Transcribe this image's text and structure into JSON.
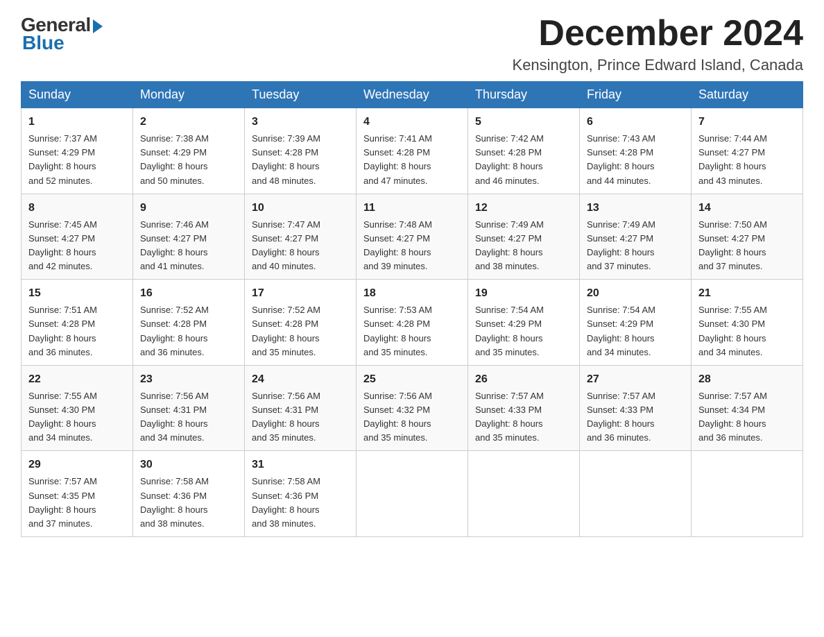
{
  "logo": {
    "general": "General",
    "blue": "Blue"
  },
  "title": "December 2024",
  "location": "Kensington, Prince Edward Island, Canada",
  "days_of_week": [
    "Sunday",
    "Monday",
    "Tuesday",
    "Wednesday",
    "Thursday",
    "Friday",
    "Saturday"
  ],
  "weeks": [
    [
      {
        "day": "1",
        "sunrise": "7:37 AM",
        "sunset": "4:29 PM",
        "daylight": "8 hours and 52 minutes."
      },
      {
        "day": "2",
        "sunrise": "7:38 AM",
        "sunset": "4:29 PM",
        "daylight": "8 hours and 50 minutes."
      },
      {
        "day": "3",
        "sunrise": "7:39 AM",
        "sunset": "4:28 PM",
        "daylight": "8 hours and 48 minutes."
      },
      {
        "day": "4",
        "sunrise": "7:41 AM",
        "sunset": "4:28 PM",
        "daylight": "8 hours and 47 minutes."
      },
      {
        "day": "5",
        "sunrise": "7:42 AM",
        "sunset": "4:28 PM",
        "daylight": "8 hours and 46 minutes."
      },
      {
        "day": "6",
        "sunrise": "7:43 AM",
        "sunset": "4:28 PM",
        "daylight": "8 hours and 44 minutes."
      },
      {
        "day": "7",
        "sunrise": "7:44 AM",
        "sunset": "4:27 PM",
        "daylight": "8 hours and 43 minutes."
      }
    ],
    [
      {
        "day": "8",
        "sunrise": "7:45 AM",
        "sunset": "4:27 PM",
        "daylight": "8 hours and 42 minutes."
      },
      {
        "day": "9",
        "sunrise": "7:46 AM",
        "sunset": "4:27 PM",
        "daylight": "8 hours and 41 minutes."
      },
      {
        "day": "10",
        "sunrise": "7:47 AM",
        "sunset": "4:27 PM",
        "daylight": "8 hours and 40 minutes."
      },
      {
        "day": "11",
        "sunrise": "7:48 AM",
        "sunset": "4:27 PM",
        "daylight": "8 hours and 39 minutes."
      },
      {
        "day": "12",
        "sunrise": "7:49 AM",
        "sunset": "4:27 PM",
        "daylight": "8 hours and 38 minutes."
      },
      {
        "day": "13",
        "sunrise": "7:49 AM",
        "sunset": "4:27 PM",
        "daylight": "8 hours and 37 minutes."
      },
      {
        "day": "14",
        "sunrise": "7:50 AM",
        "sunset": "4:27 PM",
        "daylight": "8 hours and 37 minutes."
      }
    ],
    [
      {
        "day": "15",
        "sunrise": "7:51 AM",
        "sunset": "4:28 PM",
        "daylight": "8 hours and 36 minutes."
      },
      {
        "day": "16",
        "sunrise": "7:52 AM",
        "sunset": "4:28 PM",
        "daylight": "8 hours and 36 minutes."
      },
      {
        "day": "17",
        "sunrise": "7:52 AM",
        "sunset": "4:28 PM",
        "daylight": "8 hours and 35 minutes."
      },
      {
        "day": "18",
        "sunrise": "7:53 AM",
        "sunset": "4:28 PM",
        "daylight": "8 hours and 35 minutes."
      },
      {
        "day": "19",
        "sunrise": "7:54 AM",
        "sunset": "4:29 PM",
        "daylight": "8 hours and 35 minutes."
      },
      {
        "day": "20",
        "sunrise": "7:54 AM",
        "sunset": "4:29 PM",
        "daylight": "8 hours and 34 minutes."
      },
      {
        "day": "21",
        "sunrise": "7:55 AM",
        "sunset": "4:30 PM",
        "daylight": "8 hours and 34 minutes."
      }
    ],
    [
      {
        "day": "22",
        "sunrise": "7:55 AM",
        "sunset": "4:30 PM",
        "daylight": "8 hours and 34 minutes."
      },
      {
        "day": "23",
        "sunrise": "7:56 AM",
        "sunset": "4:31 PM",
        "daylight": "8 hours and 34 minutes."
      },
      {
        "day": "24",
        "sunrise": "7:56 AM",
        "sunset": "4:31 PM",
        "daylight": "8 hours and 35 minutes."
      },
      {
        "day": "25",
        "sunrise": "7:56 AM",
        "sunset": "4:32 PM",
        "daylight": "8 hours and 35 minutes."
      },
      {
        "day": "26",
        "sunrise": "7:57 AM",
        "sunset": "4:33 PM",
        "daylight": "8 hours and 35 minutes."
      },
      {
        "day": "27",
        "sunrise": "7:57 AM",
        "sunset": "4:33 PM",
        "daylight": "8 hours and 36 minutes."
      },
      {
        "day": "28",
        "sunrise": "7:57 AM",
        "sunset": "4:34 PM",
        "daylight": "8 hours and 36 minutes."
      }
    ],
    [
      {
        "day": "29",
        "sunrise": "7:57 AM",
        "sunset": "4:35 PM",
        "daylight": "8 hours and 37 minutes."
      },
      {
        "day": "30",
        "sunrise": "7:58 AM",
        "sunset": "4:36 PM",
        "daylight": "8 hours and 38 minutes."
      },
      {
        "day": "31",
        "sunrise": "7:58 AM",
        "sunset": "4:36 PM",
        "daylight": "8 hours and 38 minutes."
      },
      null,
      null,
      null,
      null
    ]
  ],
  "labels": {
    "sunrise": "Sunrise:",
    "sunset": "Sunset:",
    "daylight": "Daylight:"
  }
}
